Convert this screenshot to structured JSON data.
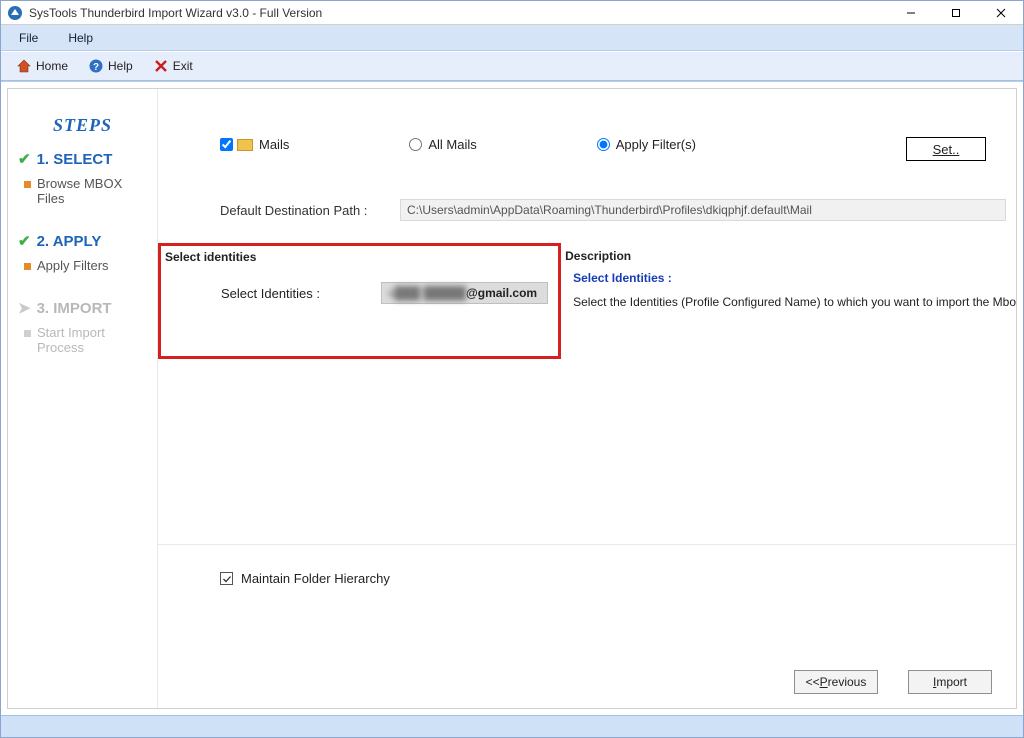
{
  "titlebar": {
    "title": "SysTools Thunderbird Import Wizard v3.0 - Full Version"
  },
  "menubar": {
    "file": "File",
    "help": "Help"
  },
  "toolbar": {
    "home": "Home",
    "help": "Help",
    "exit": "Exit"
  },
  "sidebar": {
    "heading": "STEPS",
    "step1": {
      "label": "1. SELECT",
      "sub": "Browse MBOX Files"
    },
    "step2": {
      "label": "2. APPLY",
      "sub": "Apply Filters"
    },
    "step3": {
      "label": "3. IMPORT",
      "sub": "Start Import Process"
    }
  },
  "options": {
    "mails": "Mails",
    "all_mails": "All Mails",
    "apply_filters": "Apply Filter(s)",
    "set_button": "Set.."
  },
  "path": {
    "label": "Default Destination Path :",
    "value": "C:\\Users\\admin\\AppData\\Roaming\\Thunderbird\\Profiles\\dkiqphjf.default\\Mail"
  },
  "identities": {
    "group_label": "Select identities",
    "field_label": "Select Identities :",
    "blurred_prefix": "s███ █████",
    "value_suffix": "@gmail.com"
  },
  "description": {
    "title": "Description",
    "sub": "Select Identities :",
    "text": "Select the Identities (Profile Configured Name) to  which  you want to import the Mbo"
  },
  "maintain": {
    "label": "Maintain Folder Hierarchy"
  },
  "buttons": {
    "prev_pre": "<<",
    "prev_u": "P",
    "prev_post": "revious",
    "import_u": "I",
    "import_post": "mport"
  }
}
